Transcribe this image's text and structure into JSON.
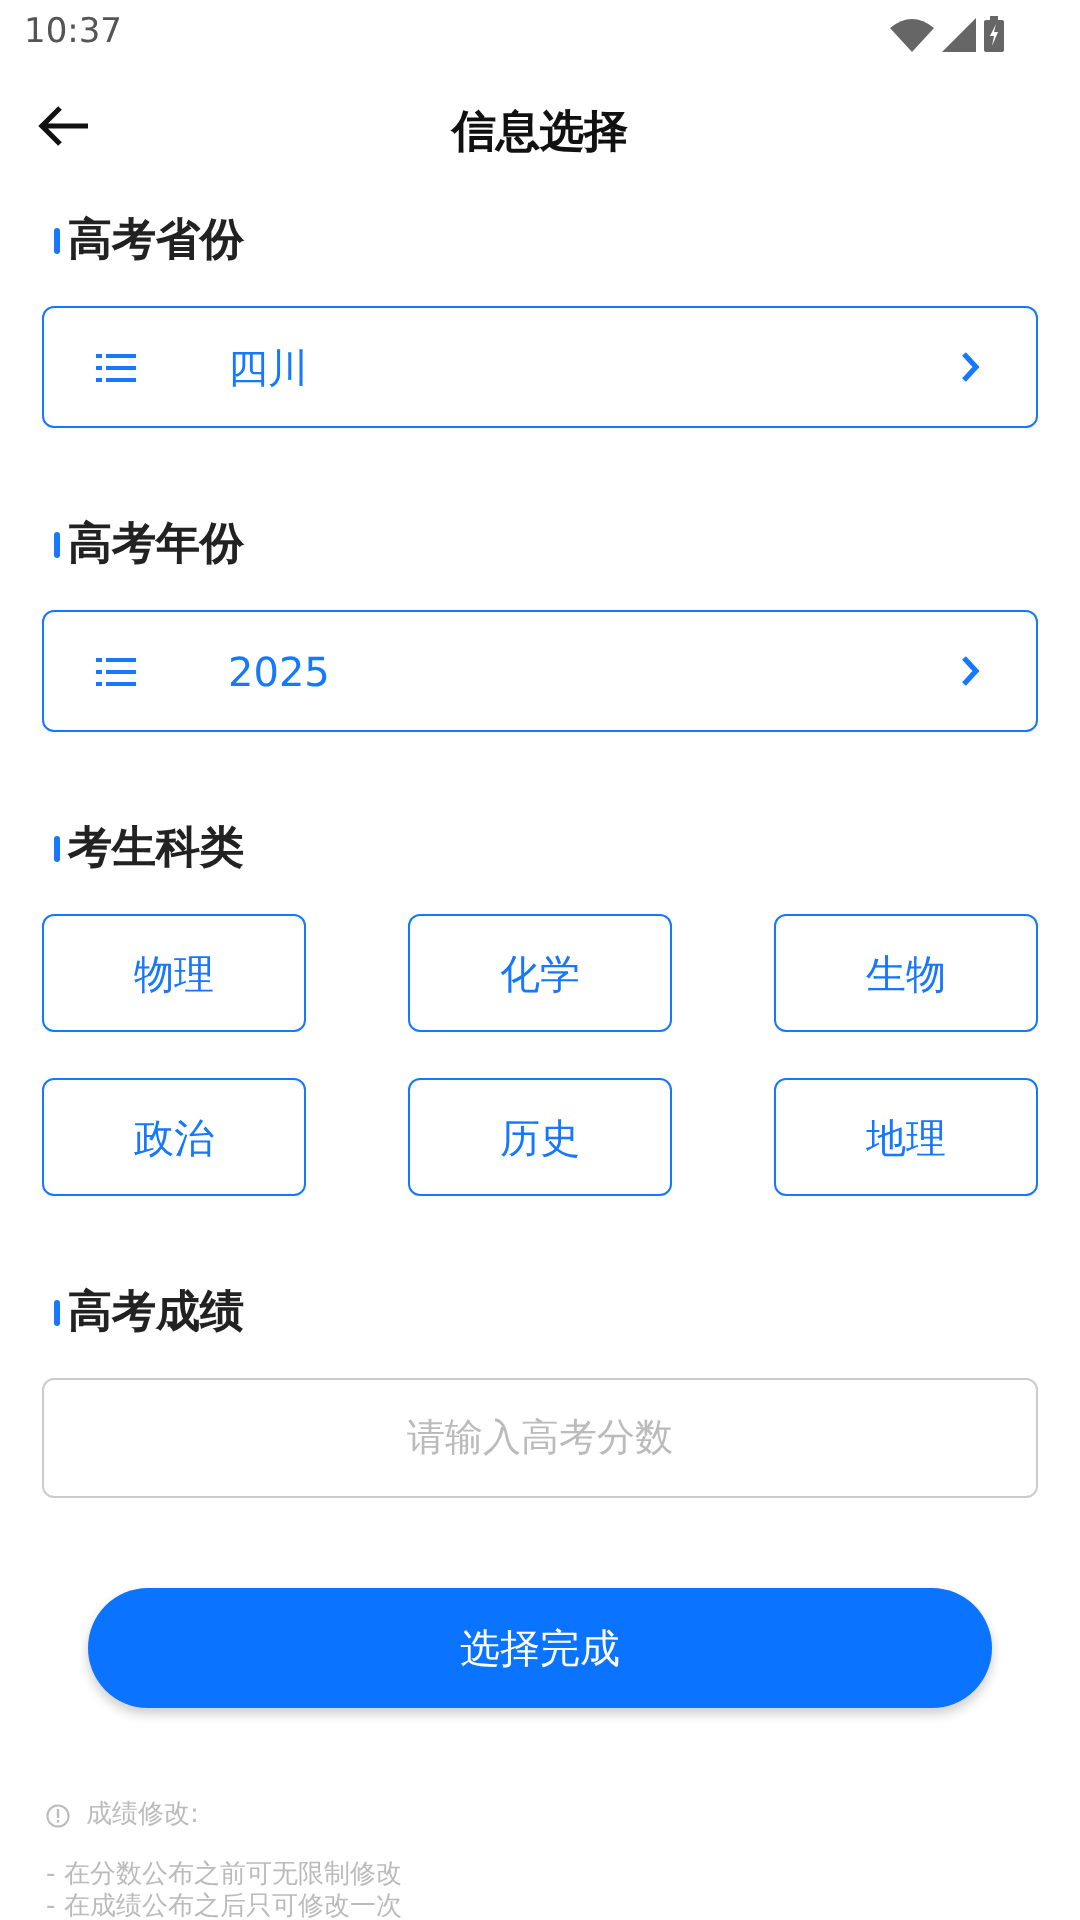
{
  "status_bar": {
    "time": "10:37"
  },
  "header": {
    "title": "信息选择"
  },
  "province": {
    "heading": "高考省份",
    "value": "四川"
  },
  "year": {
    "heading": "高考年份",
    "value": "2025"
  },
  "subjects": {
    "heading": "考生科类",
    "options": [
      {
        "label": "物理",
        "selected": false
      },
      {
        "label": "化学",
        "selected": false
      },
      {
        "label": "生物",
        "selected": false
      },
      {
        "label": "政治",
        "selected": false
      },
      {
        "label": "历史",
        "selected": false
      },
      {
        "label": "地理",
        "selected": false
      }
    ]
  },
  "score": {
    "heading": "高考成绩",
    "placeholder": "请输入高考分数"
  },
  "submit": {
    "label": "选择完成"
  },
  "note": {
    "title": "成绩修改:",
    "lines": [
      "- 在分数公布之前可无限制修改",
      "- 在成绩公布之后只可修改一次"
    ]
  }
}
